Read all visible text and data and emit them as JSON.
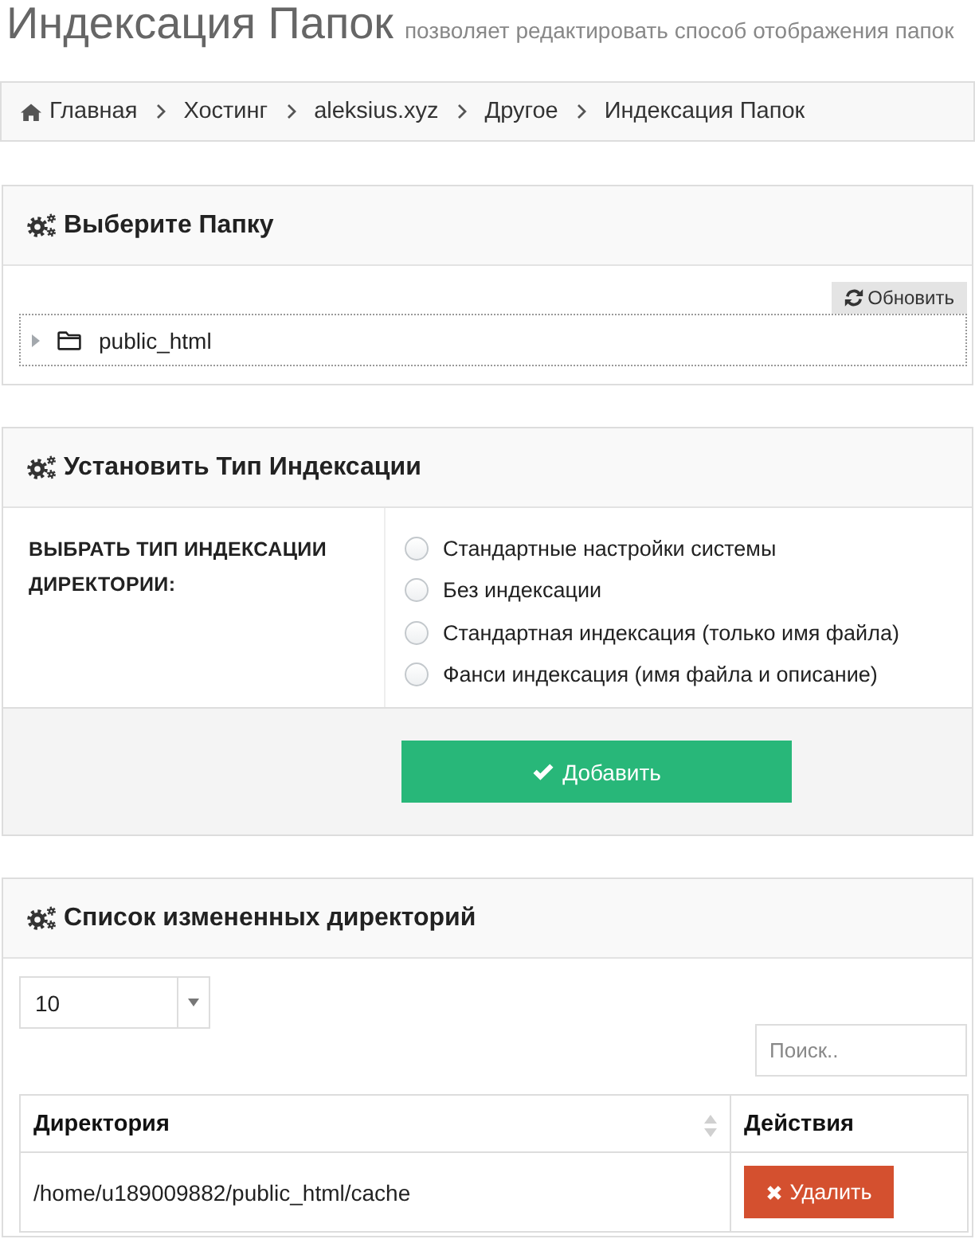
{
  "page_header": {
    "title": "Индексация Папок",
    "subtitle": "позволяет редактировать способ отображения папок"
  },
  "breadcrumb": [
    {
      "label": "Главная",
      "kind": "home"
    },
    {
      "label": "Хостинг",
      "kind": "link"
    },
    {
      "label": "aleksius.xyz",
      "kind": "link"
    },
    {
      "label": "Другое",
      "kind": "link"
    },
    {
      "label": "Индексация Папок",
      "kind": "current"
    }
  ],
  "folder_panel": {
    "title": "Выберите Папку",
    "refresh_button": "Обновить",
    "tree": [
      {
        "label": "public_html",
        "expanded": false
      }
    ]
  },
  "indexing_panel": {
    "title": "Установить Тип Индексации",
    "field_label": "ВЫБРАТЬ ТИП ИНДЕКСАЦИИ ДИРЕКТОРИИ:",
    "options": [
      {
        "label": "Стандартные настройки системы",
        "selected": false
      },
      {
        "label": "Без индексации",
        "selected": false
      },
      {
        "label": "Стандартная индексация (только имя файла)",
        "selected": false
      },
      {
        "label": "Фанси индексация (имя файла и описание)",
        "selected": false
      }
    ],
    "submit_button": "Добавить"
  },
  "directories_panel": {
    "title": "Список измененных директорий",
    "page_size": "10",
    "search": {
      "placeholder": "Поиск.."
    },
    "table": {
      "columns": [
        {
          "label": "Директория",
          "sortable": true
        },
        {
          "label": "Действия",
          "sortable": false
        }
      ],
      "rows": [
        {
          "directory": "/home/u189009882/public_html/cache",
          "delete_button": "Удалить"
        }
      ]
    }
  }
}
